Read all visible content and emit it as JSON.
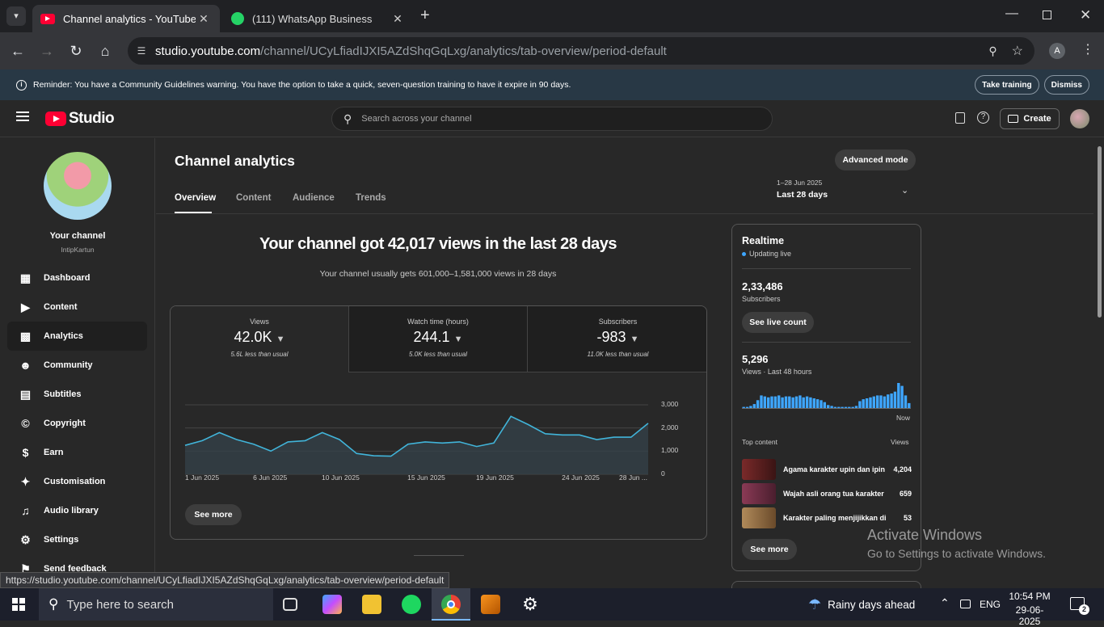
{
  "browser": {
    "tabs": [
      {
        "title": "Channel analytics - YouTube Studio"
      },
      {
        "title": "(111) WhatsApp Business"
      }
    ],
    "url_domain": "studio.youtube.com",
    "url_path": "/channel/UCyLfiadIJXI5AZdShqGqLxg/analytics/tab-overview/period-default",
    "profile_initial": "A",
    "status_url": "https://studio.youtube.com/channel/UCyLfiadIJXI5AZdShqGqLxg/analytics/tab-overview/period-default"
  },
  "banner": {
    "text": "Reminder: You have a Community Guidelines warning. You have the option to take a quick, seven-question training to have it expire in 90 days.",
    "take_training": "Take training",
    "dismiss": "Dismiss"
  },
  "header": {
    "logo_text": "Studio",
    "search_placeholder": "Search across your channel",
    "create_label": "Create"
  },
  "sidebar": {
    "channel_title": "Your channel",
    "channel_name": "IntipKartun",
    "items": [
      {
        "label": "Dashboard"
      },
      {
        "label": "Content"
      },
      {
        "label": "Analytics"
      },
      {
        "label": "Community"
      },
      {
        "label": "Subtitles"
      },
      {
        "label": "Copyright"
      },
      {
        "label": "Earn"
      },
      {
        "label": "Customisation"
      },
      {
        "label": "Audio library"
      },
      {
        "label": "Settings"
      },
      {
        "label": "Send feedback"
      }
    ]
  },
  "main": {
    "title": "Channel analytics",
    "advanced_mode": "Advanced mode",
    "tabs": [
      {
        "label": "Overview"
      },
      {
        "label": "Content"
      },
      {
        "label": "Audience"
      },
      {
        "label": "Trends"
      }
    ],
    "period_range": "1–28 Jun 2025",
    "period_label": "Last 28 days",
    "headline": "Your channel got 42,017 views in the last 28 days",
    "subheadline": "Your channel usually gets 601,000–1,581,000 views in 28 days",
    "metrics": [
      {
        "label": "Views",
        "value": "42.0K",
        "sub": "5.6L less than usual"
      },
      {
        "label": "Watch time (hours)",
        "value": "244.1",
        "sub": "5.0K less than usual"
      },
      {
        "label": "Subscribers",
        "value": "-983",
        "sub": "11.0K less than usual"
      }
    ],
    "see_more": "See more"
  },
  "chart_data": {
    "type": "area",
    "x_ticks": [
      "1 Jun 2025",
      "6 Jun 2025",
      "10 Jun 2025",
      "15 Jun 2025",
      "19 Jun 2025",
      "24 Jun 2025",
      "28 Jun ..."
    ],
    "y_ticks": [
      "3,000",
      "2,000",
      "1,000",
      "0"
    ],
    "ylim": [
      0,
      3000
    ],
    "values": [
      1250,
      1450,
      1800,
      1500,
      1300,
      1000,
      1400,
      1450,
      1800,
      1500,
      900,
      800,
      780,
      1300,
      1400,
      1350,
      1400,
      1200,
      1350,
      2500,
      2150,
      1750,
      1700,
      1700,
      1500,
      1600,
      1600,
      2200
    ]
  },
  "realtime": {
    "title": "Realtime",
    "status": "Updating live",
    "subs_value": "2,33,486",
    "subs_label": "Subscribers",
    "see_live_count": "See live count",
    "views_value": "5,296",
    "views_label": "Views · Last 48 hours",
    "now_label": "Now",
    "bars": [
      2,
      2,
      3,
      5,
      9,
      14,
      13,
      12,
      13,
      13,
      14,
      12,
      13,
      13,
      12,
      13,
      14,
      12,
      13,
      12,
      11,
      10,
      9,
      7,
      4,
      3,
      2,
      2,
      2,
      2,
      2,
      2,
      3,
      8,
      10,
      11,
      12,
      13,
      14,
      14,
      13,
      15,
      16,
      18,
      27,
      24,
      14,
      6
    ],
    "top_content_label": "Top content",
    "views_col": "Views",
    "top_content": [
      {
        "title": "Agama karakter upin dan ipin",
        "views": "4,204"
      },
      {
        "title": "Wajah asli orang tua karakter",
        "views": "659"
      },
      {
        "title": "Karakter paling menjijikkan di",
        "views": "53"
      }
    ],
    "see_more": "See more",
    "accent": "#3ea6ff"
  },
  "watermark": {
    "line1": "Activate Windows",
    "line2": "Go to Settings to activate Windows."
  },
  "taskbar": {
    "search_placeholder": "Type here to search",
    "weather": "Rainy days ahead",
    "lang": "ENG",
    "time": "10:54 PM",
    "date": "29-06-2025",
    "notif_count": "2"
  }
}
